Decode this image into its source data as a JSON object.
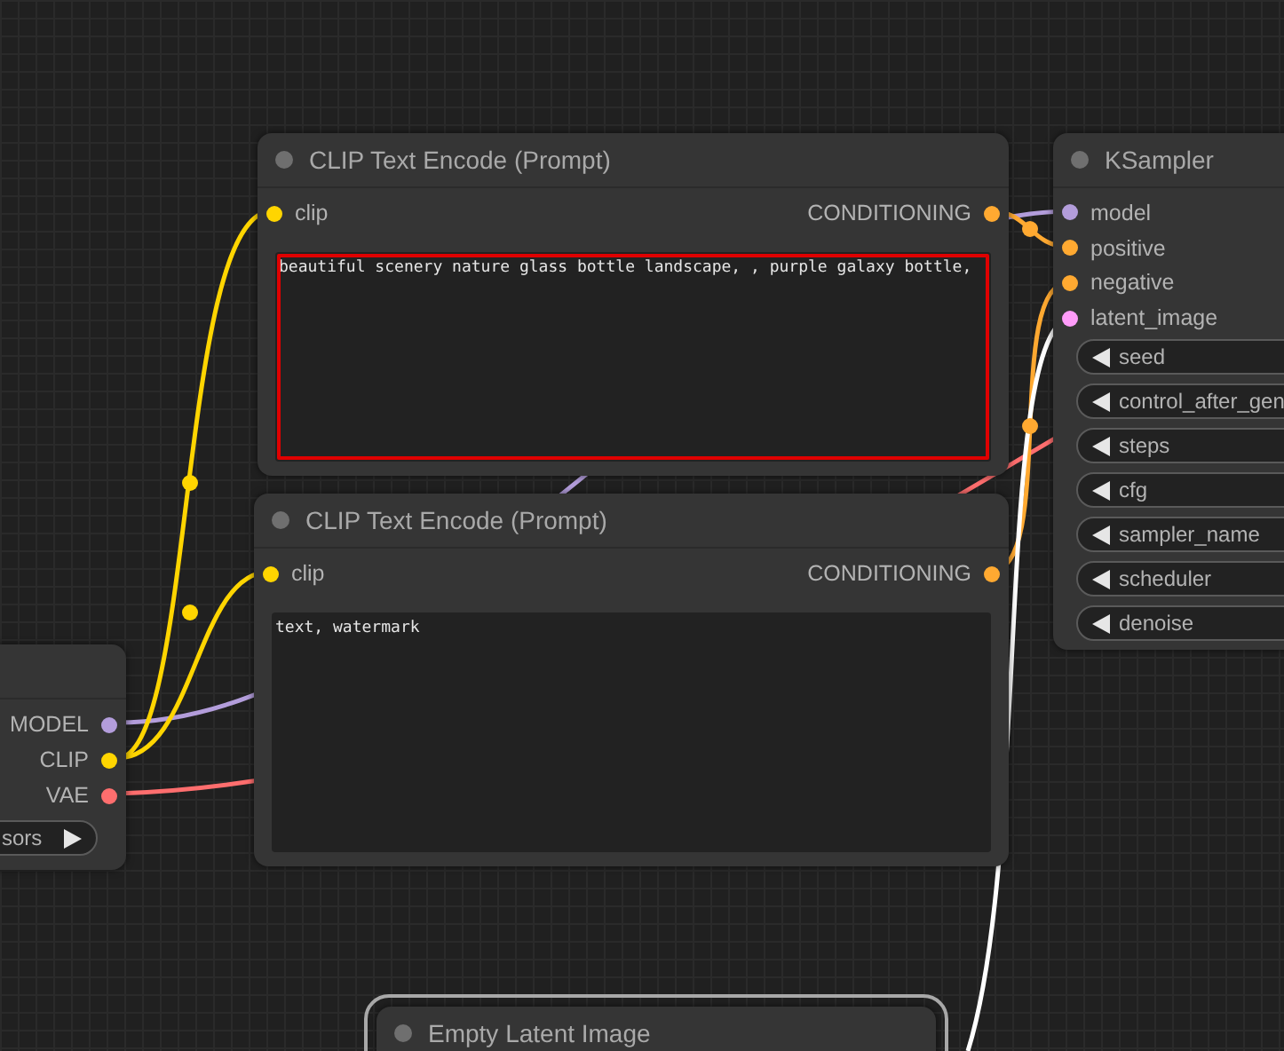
{
  "nodes": [
    {
      "kind": "loader",
      "outputs": [
        {
          "label": "MODEL",
          "color": "#b39ddb"
        },
        {
          "label": "CLIP",
          "color": "#ffd500"
        },
        {
          "label": "VAE",
          "color": "#ff6e6e"
        }
      ],
      "widgets": [
        {
          "label": "sors"
        }
      ]
    },
    {
      "kind": "text_encode",
      "title": "CLIP Text Encode (Prompt)",
      "inputs": [
        {
          "label": "clip",
          "color": "#ffd500"
        }
      ],
      "outputs": [
        {
          "label": "CONDITIONING",
          "color": "#ffa931"
        }
      ],
      "text": "beautiful scenery nature glass bottle landscape, , purple galaxy bottle,",
      "focused": true
    },
    {
      "kind": "text_encode",
      "title": "CLIP Text Encode (Prompt)",
      "inputs": [
        {
          "label": "clip",
          "color": "#ffd500"
        }
      ],
      "outputs": [
        {
          "label": "CONDITIONING",
          "color": "#ffa931"
        }
      ],
      "text": "text, watermark",
      "focused": false
    },
    {
      "kind": "sampler",
      "title": "KSampler",
      "inputs": [
        {
          "label": "model",
          "color": "#b39ddb"
        },
        {
          "label": "positive",
          "color": "#ffa931"
        },
        {
          "label": "negative",
          "color": "#ffa931"
        },
        {
          "label": "latent_image",
          "color": "#ff9cf9"
        }
      ],
      "widgets": [
        {
          "label": "seed"
        },
        {
          "label": "control_after_gen"
        },
        {
          "label": "steps"
        },
        {
          "label": "cfg"
        },
        {
          "label": "sampler_name"
        },
        {
          "label": "scheduler"
        },
        {
          "label": "denoise"
        }
      ]
    },
    {
      "kind": "latent",
      "title": "Empty Latent Image",
      "selected": true
    }
  ]
}
